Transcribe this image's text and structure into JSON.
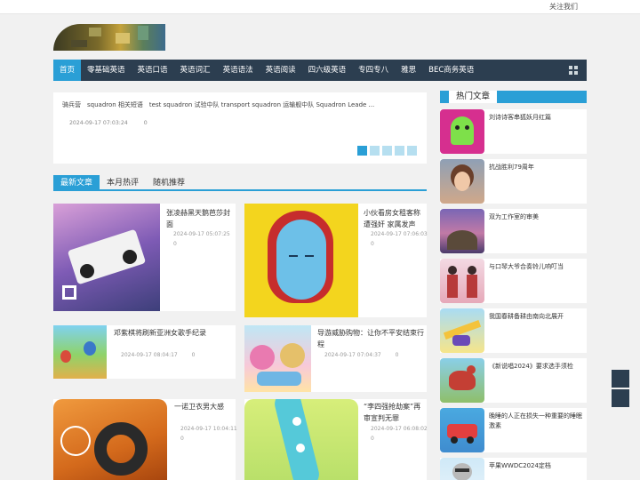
{
  "topbar": {
    "follow_label": "关注我们"
  },
  "nav": {
    "items": [
      "首页",
      "零基础英语",
      "英语口语",
      "英语词汇",
      "英语语法",
      "英语阅读",
      "四六级英语",
      "专四专八",
      "雅思",
      "BEC商务英语"
    ],
    "menu_icon": "grid-icon"
  },
  "slider": {
    "text": "骑兵营　squadron 相关短语　test squadron 试验中队 transport squadron 运输舰中队 Squadron Leade ...",
    "date": "2024-09-17 07:03:24",
    "count": "0"
  },
  "tabs": [
    "最新文章",
    "本月热评",
    "随机推荐"
  ],
  "articles": [
    {
      "title": "张凌赫黑天鹅芭莎封面",
      "date": "2024-09-17 05:07:25",
      "count": "0"
    },
    {
      "title": "小伙看房女租客称遭强奸 家属发声",
      "date": "2024-09-17 07:06:03",
      "count": "0"
    },
    {
      "title": "邓紫棋将刷新亚洲女歌手纪录",
      "date": "2024-09-17 08:04:17",
      "count": "0"
    },
    {
      "title": "导游威胁购物：让你不平安结束行程",
      "date": "2024-09-17 07:04:37",
      "count": "0"
    },
    {
      "title": "一诺卫衣男大感",
      "date": "2024-09-17 10:04:11",
      "count": "0"
    },
    {
      "title": "“李四强抢劫案”再审宣判无罪",
      "date": "2024-09-17 06:08:02",
      "count": "0"
    }
  ],
  "sidebar": {
    "title": "热门文章",
    "items": [
      "刘诗诗客串狐妖月红篇",
      "抗战胜利79周年",
      "双为工作室的审美",
      "与口琴大爷合奏铃儿响叮当",
      "我国春耕备耕由南向北展开",
      "《新说唱2024》要求选手须检",
      "晚睡的人正在损失一种重要的睡眠激素",
      "苹果WWDC2024定档"
    ]
  },
  "colors": {
    "accent": "#2a9fd6",
    "nav_bg": "#2c3e50",
    "page_bg": "#f1f1f1"
  }
}
